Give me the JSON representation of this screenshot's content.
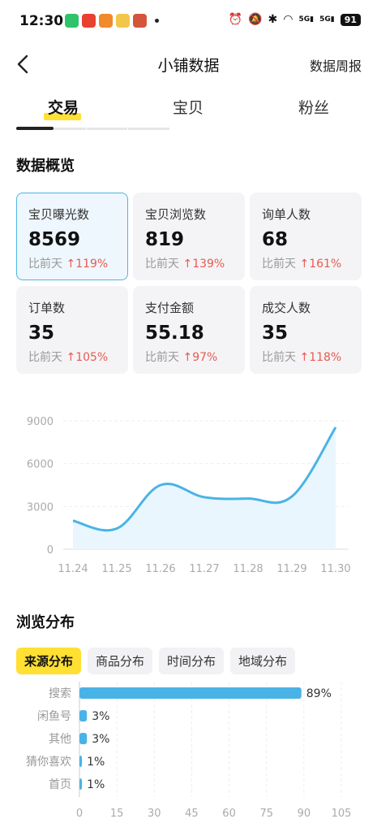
{
  "status_bar": {
    "time": "12:30",
    "battery": "91",
    "signal_1": "5G",
    "signal_2": "5G"
  },
  "nav": {
    "title": "小铺数据",
    "right_link": "数据周报"
  },
  "tabs": [
    {
      "label": "交易",
      "active": true
    },
    {
      "label": "宝贝",
      "active": false
    },
    {
      "label": "粉丝",
      "active": false
    }
  ],
  "overview": {
    "title": "数据概览",
    "compare_label": "比前天",
    "cards": [
      {
        "label": "宝贝曝光数",
        "value": "8569",
        "change": "119%",
        "selected": true
      },
      {
        "label": "宝贝浏览数",
        "value": "819",
        "change": "139%",
        "selected": false
      },
      {
        "label": "询单人数",
        "value": "68",
        "change": "161%",
        "selected": false
      },
      {
        "label": "订单数",
        "value": "35",
        "change": "105%",
        "selected": false
      },
      {
        "label": "支付金额",
        "value": "55.18",
        "change": "97%",
        "selected": false
      },
      {
        "label": "成交人数",
        "value": "35",
        "change": "118%",
        "selected": false
      }
    ]
  },
  "chart_data": [
    {
      "type": "area",
      "x": [
        "11.24",
        "11.25",
        "11.26",
        "11.27",
        "11.28",
        "11.29",
        "11.30"
      ],
      "values": [
        2000,
        1450,
        4500,
        3650,
        3550,
        3700,
        8550
      ],
      "ylim": [
        0,
        9000
      ],
      "yticks": [
        0,
        3000,
        6000,
        9000
      ],
      "grid": true,
      "color": "#4ab3e6"
    },
    {
      "type": "bar",
      "orientation": "horizontal",
      "categories": [
        "搜索",
        "闲鱼号",
        "其他",
        "猜你喜欢",
        "首页"
      ],
      "values": [
        89,
        3,
        3,
        1,
        1
      ],
      "value_labels": [
        "89%",
        "3%",
        "3%",
        "1%",
        "1%"
      ],
      "xlim": [
        0,
        105
      ],
      "xticks": [
        0,
        15,
        30,
        45,
        60,
        75,
        90,
        105
      ],
      "grid": true,
      "color": "#4ab3e6"
    }
  ],
  "distribution": {
    "title": "浏览分布",
    "tabs": [
      {
        "label": "来源分布",
        "active": true
      },
      {
        "label": "商品分布",
        "active": false
      },
      {
        "label": "时间分布",
        "active": false
      },
      {
        "label": "地域分布",
        "active": false
      }
    ]
  },
  "colors": {
    "accent_yellow": "#ffe033",
    "chart_blue": "#4ab3e6",
    "up_red": "#e85a50"
  }
}
